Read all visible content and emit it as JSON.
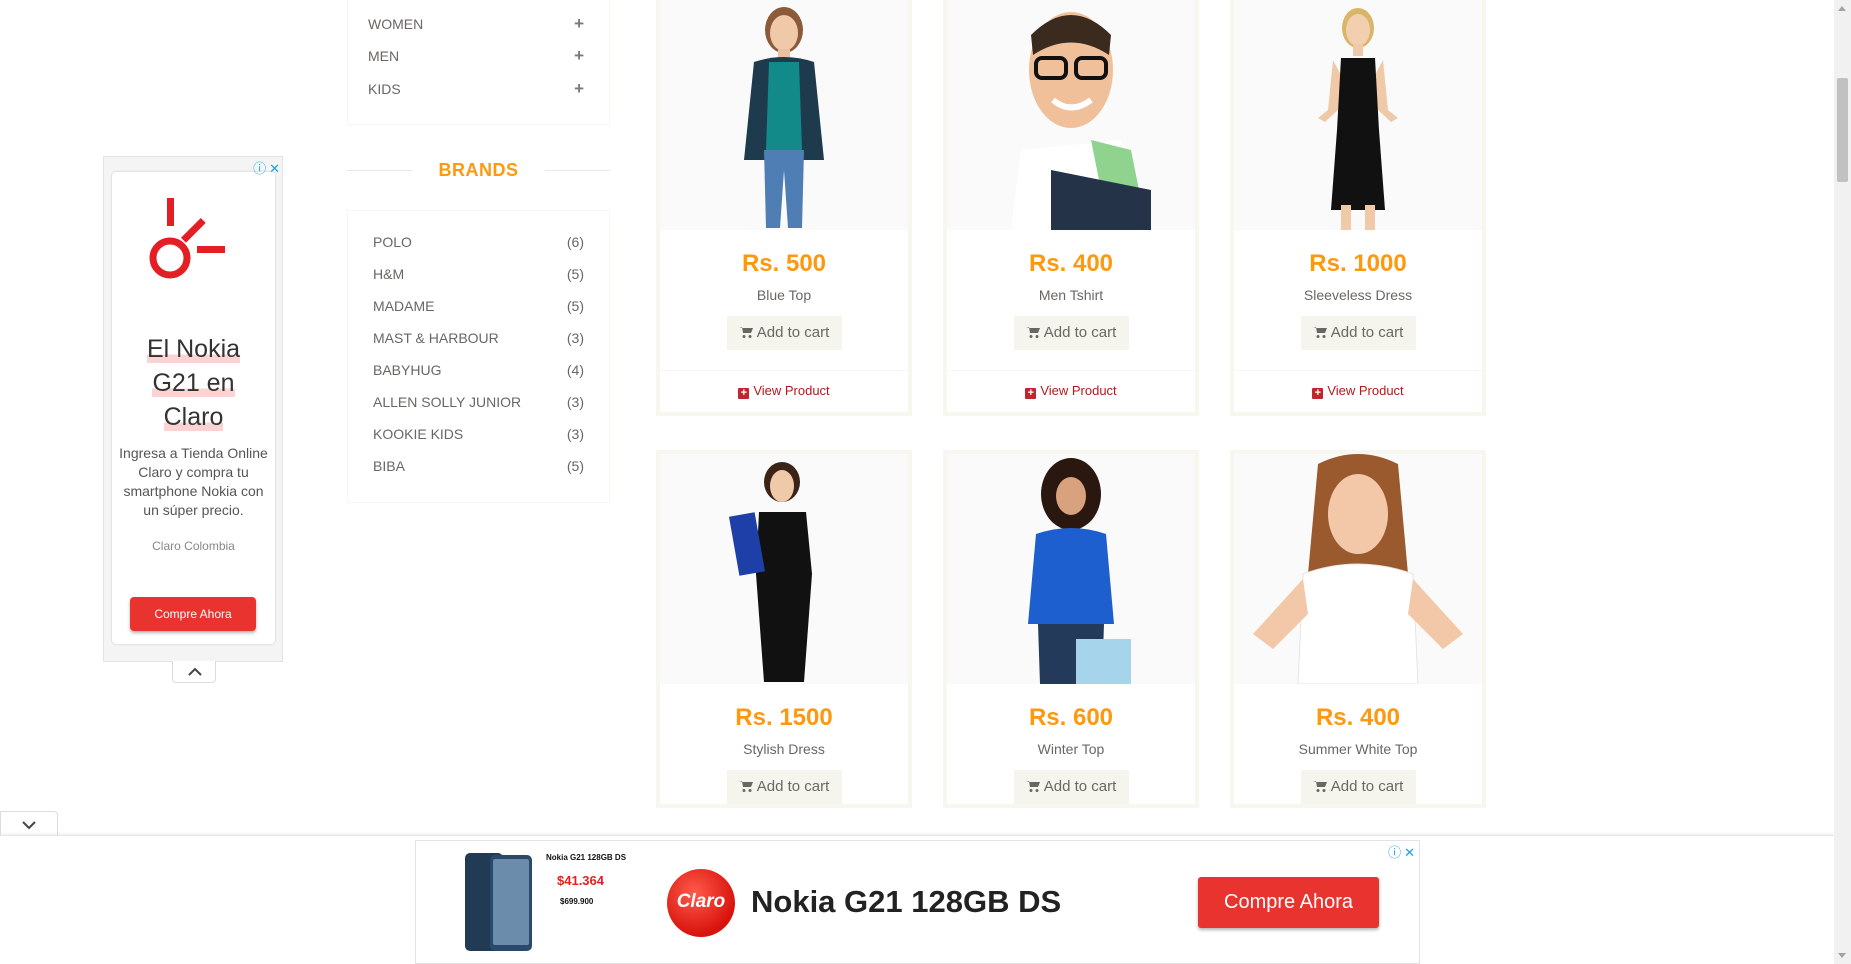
{
  "sidebar": {
    "categories": [
      {
        "label": "WOMEN"
      },
      {
        "label": "MEN"
      },
      {
        "label": "KIDS"
      }
    ],
    "brands_title": "BRANDS",
    "brands": [
      {
        "name": "POLO",
        "count": "(6)"
      },
      {
        "name": "H&M",
        "count": "(5)"
      },
      {
        "name": "MADAME",
        "count": "(5)"
      },
      {
        "name": "MAST & HARBOUR",
        "count": "(3)"
      },
      {
        "name": "BABYHUG",
        "count": "(4)"
      },
      {
        "name": "ALLEN SOLLY JUNIOR",
        "count": "(3)"
      },
      {
        "name": "KOOKIE KIDS",
        "count": "(3)"
      },
      {
        "name": "BIBA",
        "count": "(5)"
      }
    ]
  },
  "products": [
    {
      "price": "Rs. 500",
      "name": "Blue Top",
      "cart_label": "Add to cart",
      "view_label": "View Product"
    },
    {
      "price": "Rs. 400",
      "name": "Men Tshirt",
      "cart_label": "Add to cart",
      "view_label": "View Product"
    },
    {
      "price": "Rs. 1000",
      "name": "Sleeveless Dress",
      "cart_label": "Add to cart",
      "view_label": "View Product"
    },
    {
      "price": "Rs. 1500",
      "name": "Stylish Dress",
      "cart_label": "Add to cart"
    },
    {
      "price": "Rs. 600",
      "name": "Winter Top",
      "cart_label": "Add to cart"
    },
    {
      "price": "Rs. 400",
      "name": "Summer White Top",
      "cart_label": "Add to cart"
    }
  ],
  "left_ad": {
    "headline_lines": [
      "El Nokia",
      "G21 en",
      "Claro"
    ],
    "body": "Ingresa a Tienda Online Claro y compra tu smartphone Nokia con un súper precio.",
    "advertiser": "Claro Colombia",
    "cta": "Compre Ahora"
  },
  "bottom_ad": {
    "promo_title": "Nokia G21 128GB DS",
    "promo_price": "$41.364",
    "promo_old_price": "$699.900",
    "logo_text": "Claro",
    "headline": "Nokia G21 128GB DS",
    "cta": "Compre Ahora"
  },
  "colors": {
    "accent": "#fe980f",
    "view_link": "#b3191d",
    "ad_red": "#e8332e"
  }
}
